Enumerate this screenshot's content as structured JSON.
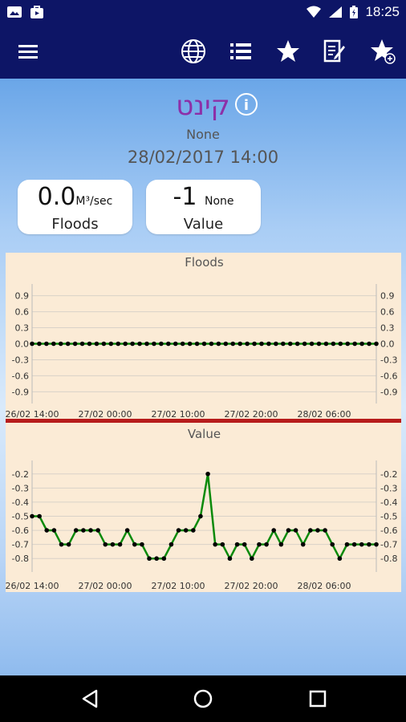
{
  "status": {
    "time": "18:25"
  },
  "toolbar": {
    "icons": [
      "menu-icon",
      "globe-icon",
      "list-icon",
      "star-icon",
      "edit-note-icon",
      "star-add-icon"
    ]
  },
  "station": {
    "name": "קינט",
    "subtitle": "None",
    "datetime": "28/02/2017 14:00"
  },
  "cards": [
    {
      "value": "0.0",
      "unit": "M³/sec",
      "label": "Floods"
    },
    {
      "value": "-1",
      "unit": "None",
      "label": "Value"
    }
  ],
  "chart_data": [
    {
      "type": "line",
      "title": "Floods",
      "xticks": [
        "26/02 14:00",
        "27/02 00:00",
        "27/02 10:00",
        "27/02 20:00",
        "28/02 06:00"
      ],
      "yticks": [
        "0.9",
        "0.6",
        "0.3",
        "0.0",
        "-0.3",
        "-0.6",
        "-0.9"
      ],
      "ylim": [
        -1.0,
        1.0
      ],
      "series": [
        {
          "values": [
            0,
            0,
            0,
            0,
            0,
            0,
            0,
            0,
            0,
            0,
            0,
            0,
            0,
            0,
            0,
            0,
            0,
            0,
            0,
            0,
            0,
            0,
            0,
            0,
            0,
            0,
            0,
            0,
            0,
            0,
            0,
            0,
            0,
            0,
            0,
            0,
            0,
            0,
            0,
            0,
            0,
            0,
            0,
            0,
            0,
            0,
            0,
            0,
            0
          ]
        }
      ],
      "colors": {
        "line": "#0a8a0a",
        "point": "#000000"
      }
    },
    {
      "type": "line",
      "title": "Value",
      "xticks": [
        "26/02 14:00",
        "27/02 00:00",
        "27/02 10:00",
        "27/02 20:00",
        "28/02 06:00"
      ],
      "yticks": [
        "-0.2",
        "-0.3",
        "-0.4",
        "-0.5",
        "-0.6",
        "-0.7",
        "-0.8"
      ],
      "ylim": [
        -0.85,
        -0.15
      ],
      "series": [
        {
          "values": [
            -0.5,
            -0.5,
            -0.6,
            -0.6,
            -0.7,
            -0.7,
            -0.6,
            -0.6,
            -0.6,
            -0.6,
            -0.7,
            -0.7,
            -0.7,
            -0.6,
            -0.7,
            -0.7,
            -0.8,
            -0.8,
            -0.8,
            -0.7,
            -0.6,
            -0.6,
            -0.6,
            -0.5,
            -0.2,
            -0.7,
            -0.7,
            -0.8,
            -0.7,
            -0.7,
            -0.8,
            -0.7,
            -0.7,
            -0.6,
            -0.7,
            -0.6,
            -0.6,
            -0.7,
            -0.6,
            -0.6,
            -0.6,
            -0.7,
            -0.8,
            -0.7,
            -0.7,
            -0.7,
            -0.7,
            -0.7
          ]
        }
      ],
      "colors": {
        "line": "#0a8a0a",
        "point": "#000000"
      }
    }
  ]
}
